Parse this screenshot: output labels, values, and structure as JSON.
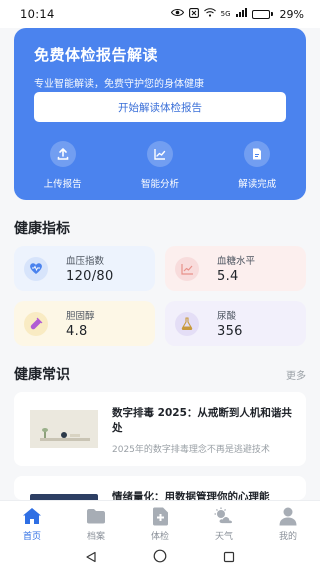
{
  "status_bar": {
    "time": "10:14",
    "signal_label": "5G",
    "battery": "29%",
    "battery_level": 0.29
  },
  "hero": {
    "title": "免费体检报告解读",
    "subtitle": "专业智能解读，免费守护您的身体健康",
    "cta_label": "开始解读体检报告",
    "steps": [
      {
        "label": "上传报告",
        "icon": "upload-icon"
      },
      {
        "label": "智能分析",
        "icon": "chart-icon"
      },
      {
        "label": "解读完成",
        "icon": "document-icon"
      }
    ]
  },
  "health_metrics": {
    "title": "健康指标",
    "items": [
      {
        "label": "血压指数",
        "value": "120/80",
        "icon": "heartbeat-icon",
        "bg": "#edf3fd",
        "icon_bg": "#d7e4fb",
        "icon_color": "#4b83ee"
      },
      {
        "label": "血糖水平",
        "value": "5.4",
        "icon": "trend-chart-icon",
        "bg": "#fcefee",
        "icon_bg": "#f8dcdc",
        "icon_color": "#e8918a"
      },
      {
        "label": "胆固醇",
        "value": "4.8",
        "icon": "test-tube-icon",
        "bg": "#fdf7e6",
        "icon_bg": "#f9ebc3",
        "icon_color": "#b15bd4"
      },
      {
        "label": "尿酸",
        "value": "356",
        "icon": "flask-icon",
        "bg": "#f2f0fb",
        "icon_bg": "#e4def6",
        "icon_color": "#c89a3c"
      }
    ]
  },
  "health_knowledge": {
    "title": "健康常识",
    "more_label": "更多",
    "articles": [
      {
        "title": "数字排毒 2025：从戒断到人机和谐共处",
        "desc": "2025年的数字排毒理念不再是逃避技术"
      },
      {
        "title": "情绪量化：用数据管理你的心理能",
        "desc": ""
      }
    ]
  },
  "tab_bar": {
    "active_color": "#2f6fe4",
    "inactive_color": "#a7adb5",
    "items": [
      {
        "label": "首页",
        "icon": "home-icon",
        "active": true
      },
      {
        "label": "档案",
        "icon": "folder-icon",
        "active": false
      },
      {
        "label": "体检",
        "icon": "medical-add-icon",
        "active": false
      },
      {
        "label": "天气",
        "icon": "weather-icon",
        "active": false
      },
      {
        "label": "我的",
        "icon": "user-icon",
        "active": false
      }
    ]
  }
}
